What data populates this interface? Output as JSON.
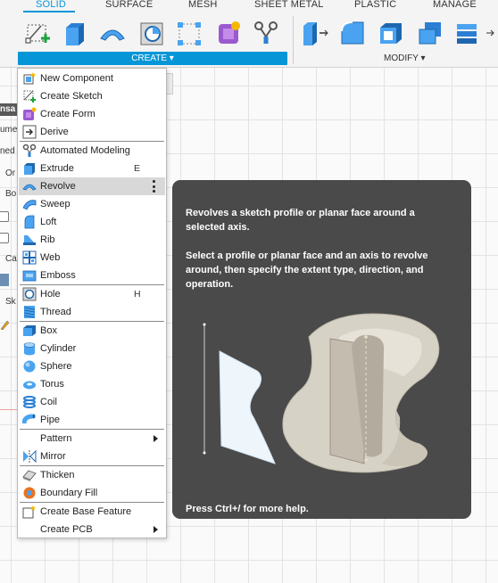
{
  "toolbar": {
    "tabs": [
      "SOLID",
      "SURFACE",
      "MESH",
      "SHEET METAL",
      "PLASTIC",
      "MANAGE"
    ],
    "create_label": "CREATE ▾",
    "modify_label": "MODIFY ▾"
  },
  "browser": {
    "header": "nsa",
    "fragments": [
      "ume",
      "ned V",
      "Or",
      "Bo",
      "Ca",
      "Sk"
    ]
  },
  "menu": {
    "items": [
      {
        "label": "New Component",
        "icon": "new-component-icon",
        "shortcut": ""
      },
      {
        "label": "Create Sketch",
        "icon": "create-sketch-icon",
        "shortcut": ""
      },
      {
        "label": "Create Form",
        "icon": "create-form-icon",
        "shortcut": ""
      },
      {
        "label": "Derive",
        "icon": "derive-icon",
        "shortcut": ""
      },
      {
        "label": "Automated Modeling",
        "icon": "automated-modeling-icon",
        "shortcut": ""
      },
      {
        "label": "Extrude",
        "icon": "extrude-icon",
        "shortcut": "E"
      },
      {
        "label": "Revolve",
        "icon": "revolve-icon",
        "shortcut": ""
      },
      {
        "label": "Sweep",
        "icon": "sweep-icon",
        "shortcut": ""
      },
      {
        "label": "Loft",
        "icon": "loft-icon",
        "shortcut": ""
      },
      {
        "label": "Rib",
        "icon": "rib-icon",
        "shortcut": ""
      },
      {
        "label": "Web",
        "icon": "web-icon",
        "shortcut": ""
      },
      {
        "label": "Emboss",
        "icon": "emboss-icon",
        "shortcut": ""
      },
      {
        "label": "Hole",
        "icon": "hole-icon",
        "shortcut": "H"
      },
      {
        "label": "Thread",
        "icon": "thread-icon",
        "shortcut": ""
      },
      {
        "label": "Box",
        "icon": "box-icon",
        "shortcut": ""
      },
      {
        "label": "Cylinder",
        "icon": "cylinder-icon",
        "shortcut": ""
      },
      {
        "label": "Sphere",
        "icon": "sphere-icon",
        "shortcut": ""
      },
      {
        "label": "Torus",
        "icon": "torus-icon",
        "shortcut": ""
      },
      {
        "label": "Coil",
        "icon": "coil-icon",
        "shortcut": ""
      },
      {
        "label": "Pipe",
        "icon": "pipe-icon",
        "shortcut": ""
      },
      {
        "label": "Pattern",
        "icon": "",
        "shortcut": ""
      },
      {
        "label": "Mirror",
        "icon": "mirror-icon",
        "shortcut": ""
      },
      {
        "label": "Thicken",
        "icon": "thicken-icon",
        "shortcut": ""
      },
      {
        "label": "Boundary Fill",
        "icon": "boundary-fill-icon",
        "shortcut": ""
      },
      {
        "label": "Create Base Feature",
        "icon": "create-base-feature-icon",
        "shortcut": ""
      },
      {
        "label": "Create PCB",
        "icon": "",
        "shortcut": ""
      }
    ],
    "highlighted": "Revolve"
  },
  "tooltip": {
    "title": "Revolves a sketch profile or planar face around a selected axis.",
    "body": "Select a profile or planar face and an axis to revolve around, then specify the extent type, direction, and operation.",
    "footer": "Press Ctrl+/ for more help."
  }
}
